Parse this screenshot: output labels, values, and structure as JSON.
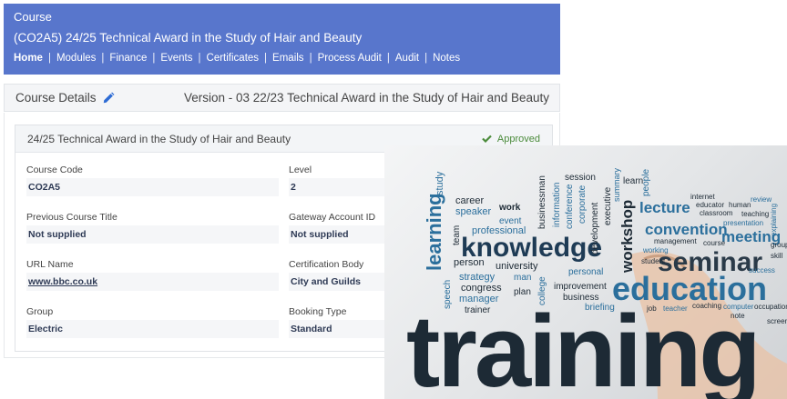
{
  "header": {
    "label": "Course",
    "title": "(CO2A5) 24/25 Technical Award in the Study of Hair and Beauty",
    "nav": [
      "Home",
      "Modules",
      "Finance",
      "Events",
      "Certificates",
      "Emails",
      "Process Audit",
      "Audit",
      "Notes"
    ],
    "active_nav": "Home"
  },
  "details": {
    "heading": "Course Details",
    "version": "Version - 03 22/23 Technical Award in the Study of Hair and Beauty"
  },
  "card": {
    "name": "24/25 Technical Award in the Study of Hair and Beauty",
    "status": "Approved",
    "fields": {
      "course_code": {
        "label": "Course Code",
        "value": "CO2A5"
      },
      "level": {
        "label": "Level",
        "value": "2"
      },
      "previous_title": {
        "label": "Previous Course Title",
        "value": "Not supplied"
      },
      "gateway_id": {
        "label": "Gateway Account ID",
        "value": "Not supplied"
      },
      "url_name": {
        "label": "URL Name",
        "value": "www.bbc.co.uk"
      },
      "cert_body": {
        "label": "Certification Body",
        "value": "City and Guilds"
      },
      "group": {
        "label": "Group",
        "value": "Electric"
      },
      "booking_type": {
        "label": "Booking Type",
        "value": "Standard"
      }
    }
  },
  "wordcloud": {
    "big_word": "training",
    "words": [
      "knowledge",
      "education",
      "seminar",
      "convention",
      "meeting",
      "lecture",
      "workshop",
      "learning",
      "study",
      "career",
      "speaker",
      "work",
      "event",
      "professional",
      "team",
      "person",
      "university",
      "strategy",
      "congress",
      "manager",
      "trainer",
      "plan",
      "man",
      "college",
      "speech",
      "improvement",
      "business",
      "briefing",
      "personal",
      "development",
      "session",
      "businessman",
      "information",
      "conference",
      "corporate",
      "executive",
      "summary",
      "learn",
      "people",
      "internet",
      "educator",
      "human",
      "review",
      "classroom",
      "teaching",
      "presentation",
      "management",
      "course",
      "working",
      "student",
      "success",
      "job",
      "teacher",
      "coaching",
      "computer",
      "occupation",
      "note",
      "screen",
      "group",
      "skill",
      "explaining"
    ]
  },
  "colors": {
    "header_bg": "#5876cc",
    "approved": "#4b8b3b",
    "wc_dark": "#1d2a35",
    "wc_blue": "#2b6f9c"
  }
}
